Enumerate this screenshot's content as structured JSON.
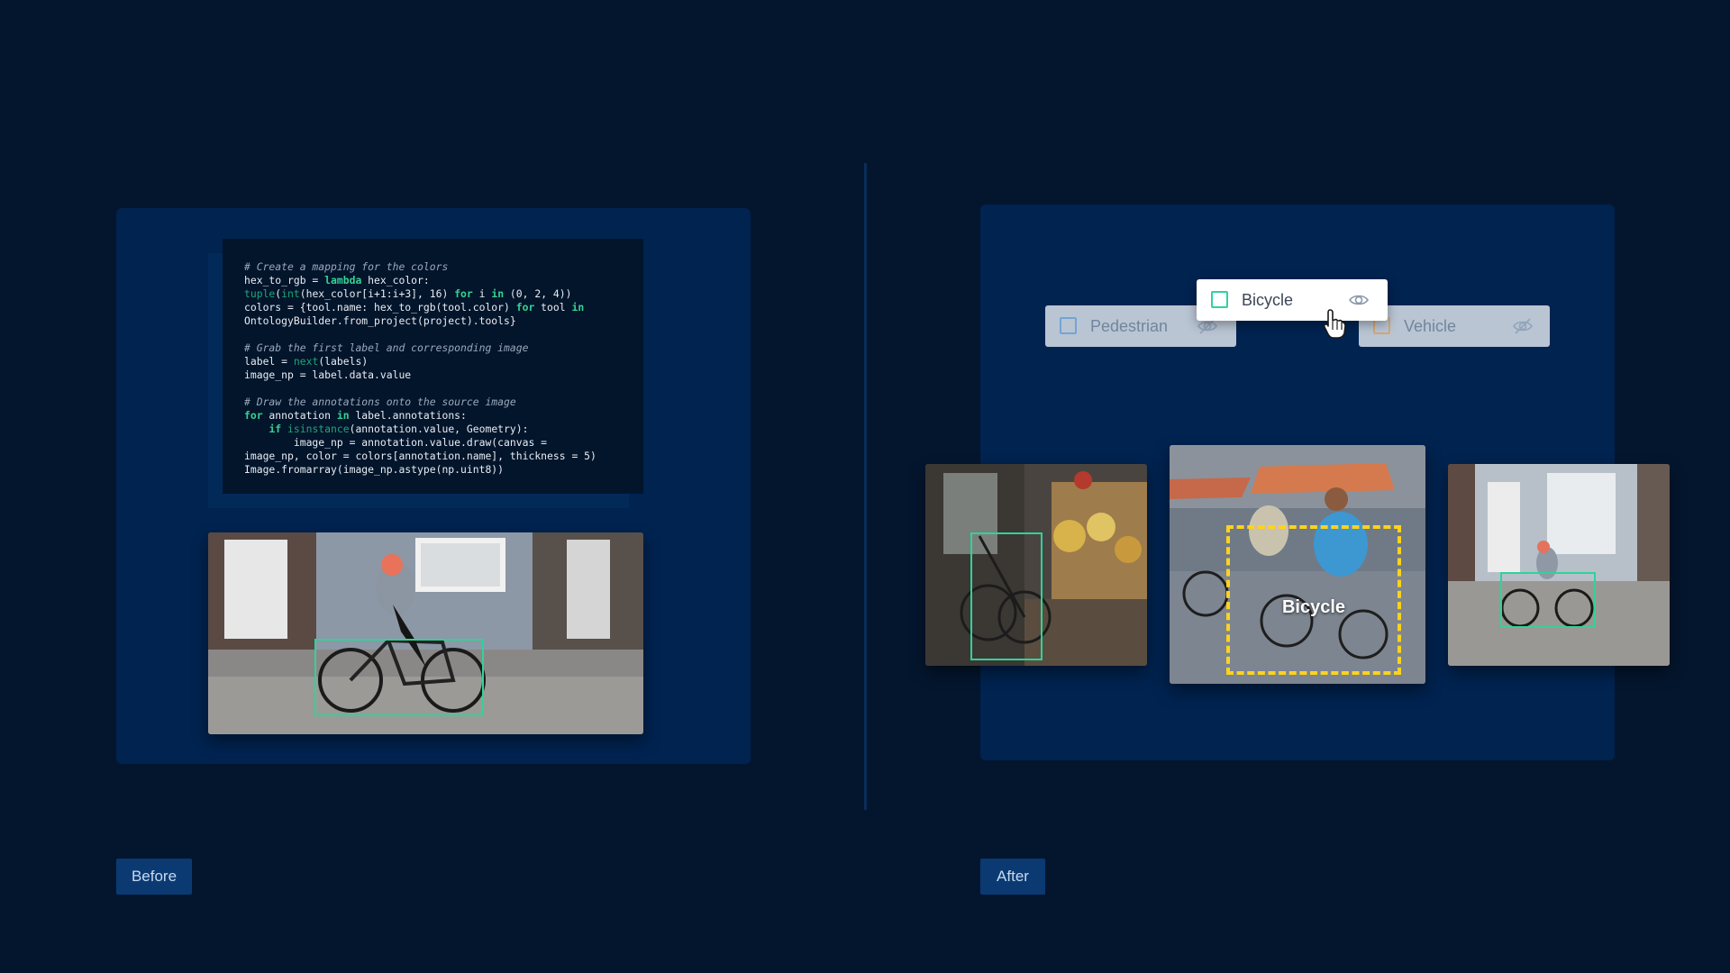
{
  "code": {
    "lines": [
      {
        "type": "comment",
        "text": "# Create a mapping for the colors"
      },
      {
        "type": "code",
        "tokens": [
          [
            "t",
            "hex_to_rgb = "
          ],
          [
            "kw",
            "lambda"
          ],
          [
            "t",
            " hex_color:"
          ]
        ]
      },
      {
        "type": "code",
        "tokens": [
          [
            "bi",
            "tuple"
          ],
          [
            "t",
            "("
          ],
          [
            "bi",
            "int"
          ],
          [
            "t",
            "(hex_color[i+1:i+3], 16) "
          ],
          [
            "kw",
            "for"
          ],
          [
            "t",
            " i "
          ],
          [
            "kw",
            "in"
          ],
          [
            "t",
            " (0, 2, 4))"
          ]
        ]
      },
      {
        "type": "code",
        "tokens": [
          [
            "t",
            "colors = {tool.name: hex_to_rgb(tool.color) "
          ],
          [
            "kw",
            "for"
          ],
          [
            "t",
            " tool "
          ],
          [
            "kw",
            "in"
          ]
        ]
      },
      {
        "type": "code",
        "tokens": [
          [
            "t",
            "OntologyBuilder.from_project(project).tools}"
          ]
        ]
      },
      {
        "type": "blank",
        "text": ""
      },
      {
        "type": "comment",
        "text": "# Grab the first label and corresponding image"
      },
      {
        "type": "code",
        "tokens": [
          [
            "t",
            "label = "
          ],
          [
            "bi",
            "next"
          ],
          [
            "t",
            "(labels)"
          ]
        ]
      },
      {
        "type": "code",
        "tokens": [
          [
            "t",
            "image_np = label.data.value"
          ]
        ]
      },
      {
        "type": "blank",
        "text": ""
      },
      {
        "type": "comment",
        "text": "# Draw the annotations onto the source image"
      },
      {
        "type": "code",
        "tokens": [
          [
            "kw",
            "for"
          ],
          [
            "t",
            " annotation "
          ],
          [
            "kw",
            "in"
          ],
          [
            "t",
            " label.annotations:"
          ]
        ]
      },
      {
        "type": "code",
        "tokens": [
          [
            "t",
            "    "
          ],
          [
            "kw",
            "if"
          ],
          [
            "t",
            " "
          ],
          [
            "bi",
            "isinstance"
          ],
          [
            "t",
            "(annotation.value, Geometry):"
          ]
        ]
      },
      {
        "type": "code",
        "tokens": [
          [
            "t",
            "        image_np = annotation.value.draw(canvas ="
          ]
        ]
      },
      {
        "type": "code",
        "tokens": [
          [
            "t",
            "image_np, color = colors[annotation.name], thickness = 5)"
          ]
        ]
      },
      {
        "type": "code",
        "tokens": [
          [
            "t",
            "Image.fromarray(image_np.astype(np.uint8))"
          ]
        ]
      }
    ]
  },
  "chips": {
    "pedestrian": {
      "label": "Pedestrian",
      "color": "#7fb0e0"
    },
    "bicycle": {
      "label": "Bicycle",
      "color": "#2fd39a"
    },
    "vehicle": {
      "label": "Vehicle",
      "color": "#e8b27a"
    }
  },
  "annotation": {
    "caption": "Bicycle",
    "color": "#ffd21e"
  },
  "tags": {
    "before": "Before",
    "after": "After"
  },
  "icons": {
    "eye": "eye-icon",
    "eye_off": "eye-off-icon",
    "cursor": "hand-pointer-icon"
  },
  "colors": {
    "background": "#04162e",
    "panel": "#002350",
    "code_bg": "#03152b",
    "keyword": "#35d394",
    "bbox_green": "#2fd39a"
  }
}
